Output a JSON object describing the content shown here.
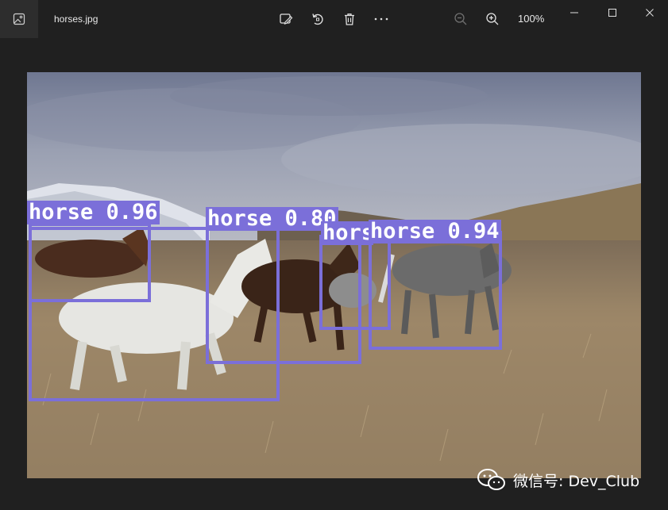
{
  "window": {
    "filename": "horses.jpg",
    "zoom": "100%"
  },
  "toolbar": {
    "edit_icon": "edit-image-icon",
    "rotate_icon": "rotate-icon",
    "delete_icon": "trash-icon",
    "more_icon": "more-icon",
    "zoom_out_icon": "zoom-out-icon",
    "zoom_in_icon": "zoom-in-icon"
  },
  "detections": [
    {
      "label": "horse 0.96"
    },
    {
      "label": "horse 0.80"
    },
    {
      "label": "hors"
    },
    {
      "label": "horse 0.94"
    }
  ],
  "watermark": {
    "text": "微信号: Dev_Club"
  },
  "colors": {
    "box": "#7b6fd9",
    "background": "#202020"
  }
}
